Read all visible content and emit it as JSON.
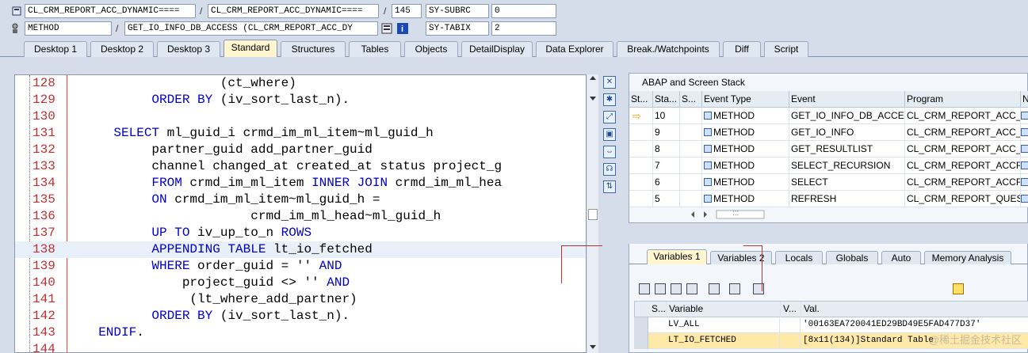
{
  "header": {
    "row1": {
      "class1": "CL_CRM_REPORT_ACC_DYNAMIC====",
      "class2": "CL_CRM_REPORT_ACC_DYNAMIC====",
      "line": "145",
      "sysfield": "SY-SUBRC",
      "sysvalue": "0"
    },
    "row2": {
      "type": "METHOD",
      "method": "GET_IO_INFO_DB_ACCESS (CL_CRM_REPORT_ACC_DY",
      "sysfield": "SY-TABIX",
      "sysvalue": "2"
    },
    "separator": "/"
  },
  "tabs": [
    {
      "label": "Desktop 1"
    },
    {
      "label": "Desktop 2"
    },
    {
      "label": "Desktop 3"
    },
    {
      "label": "Standard"
    },
    {
      "label": "Structures"
    },
    {
      "label": "Tables"
    },
    {
      "label": "Objects"
    },
    {
      "label": "DetailDisplay"
    },
    {
      "label": "Data Explorer"
    },
    {
      "label": "Break./Watchpoints"
    },
    {
      "label": "Diff"
    },
    {
      "label": "Script"
    }
  ],
  "editor": {
    "lines": [
      {
        "num": "128",
        "parts": [
          [
            "",
            "                  (ct_where)"
          ]
        ]
      },
      {
        "num": "129",
        "parts": [
          [
            "",
            "         "
          ],
          [
            "kw",
            "ORDER BY"
          ],
          [
            "",
            " (iv_sort_last_n)."
          ]
        ]
      },
      {
        "num": "130",
        "parts": [
          [
            "",
            ""
          ]
        ]
      },
      {
        "num": "131",
        "parts": [
          [
            "",
            "    "
          ],
          [
            "kw",
            "SELECT"
          ],
          [
            "",
            " ml_guid_i crmd_im_ml_item~ml_guid_h"
          ]
        ]
      },
      {
        "num": "132",
        "parts": [
          [
            "",
            "         partner_guid add_partner_guid"
          ]
        ]
      },
      {
        "num": "133",
        "parts": [
          [
            "",
            "         channel changed_at created_at status project_g"
          ]
        ]
      },
      {
        "num": "134",
        "parts": [
          [
            "",
            "         "
          ],
          [
            "kw",
            "FROM"
          ],
          [
            "",
            " crmd_im_ml_item "
          ],
          [
            "kw",
            "INNER JOIN"
          ],
          [
            "",
            " crmd_im_ml_hea"
          ]
        ]
      },
      {
        "num": "135",
        "parts": [
          [
            "",
            "         "
          ],
          [
            "kw",
            "ON"
          ],
          [
            "",
            " crmd_im_ml_item~ml_guid_h ="
          ]
        ]
      },
      {
        "num": "136",
        "parts": [
          [
            "",
            "                      crmd_im_ml_head~ml_guid_h"
          ]
        ]
      },
      {
        "num": "137",
        "parts": [
          [
            "",
            "         "
          ],
          [
            "kw",
            "UP TO"
          ],
          [
            "",
            " iv_up_to_n "
          ],
          [
            "kw",
            "ROWS"
          ]
        ]
      },
      {
        "num": "138",
        "parts": [
          [
            "",
            "         "
          ],
          [
            "kw",
            "APPENDING TABLE"
          ],
          [
            "",
            " lt_io_fetched"
          ]
        ]
      },
      {
        "num": "139",
        "parts": [
          [
            "",
            "         "
          ],
          [
            "kw",
            "WHERE"
          ],
          [
            "",
            " order_guid = '' "
          ],
          [
            "kw",
            "AND"
          ]
        ]
      },
      {
        "num": "140",
        "parts": [
          [
            "",
            "             project_guid <> '' "
          ],
          [
            "kw",
            "AND"
          ]
        ]
      },
      {
        "num": "141",
        "parts": [
          [
            "",
            "              (lt_where_add_partner)"
          ]
        ]
      },
      {
        "num": "142",
        "parts": [
          [
            "",
            "         "
          ],
          [
            "kw",
            "ORDER BY"
          ],
          [
            "",
            " (iv_sort_last_n)."
          ]
        ]
      },
      {
        "num": "143",
        "parts": [
          [
            "",
            "  "
          ],
          [
            "kw",
            "ENDIF"
          ],
          [
            "",
            "."
          ]
        ]
      },
      {
        "num": "144",
        "parts": [
          [
            "",
            ""
          ]
        ]
      }
    ],
    "highlight_line": "138"
  },
  "stack": {
    "title": "ABAP and Screen Stack",
    "columns": [
      "St...",
      "Sta...",
      "S...",
      "Event Type",
      "Event",
      "Program",
      "N"
    ],
    "rows": [
      {
        "level": "10",
        "type": "METHOD",
        "event": "GET_IO_INFO_DB_ACCE...",
        "program": "CL_CRM_REPORT_ACC_...",
        "current": true
      },
      {
        "level": "9",
        "type": "METHOD",
        "event": "GET_IO_INFO",
        "program": "CL_CRM_REPORT_ACC_...",
        "current": false
      },
      {
        "level": "8",
        "type": "METHOD",
        "event": "GET_RESULTLIST",
        "program": "CL_CRM_REPORT_ACC_...",
        "current": false
      },
      {
        "level": "7",
        "type": "METHOD",
        "event": "SELECT_RECURSION",
        "program": "CL_CRM_REPORT_ACCR...",
        "current": false
      },
      {
        "level": "6",
        "type": "METHOD",
        "event": "SELECT",
        "program": "CL_CRM_REPORT_ACCR...",
        "current": false
      },
      {
        "level": "5",
        "type": "METHOD",
        "event": "REFRESH",
        "program": "CL_CRM_REPORT_QUES...",
        "current": false
      }
    ],
    "scroll_label": ":::"
  },
  "variables": {
    "tabs": [
      "Variables 1",
      "Variables 2",
      "Locals",
      "Globals",
      "Auto",
      "Memory Analysis"
    ],
    "columns": [
      "S...",
      "Variable",
      "V...",
      "Val."
    ],
    "rows": [
      {
        "name": "LV_ALL",
        "value": "'00163EA720041ED29BD49E5FAD477D37'",
        "selected": false
      },
      {
        "name": "LT_IO_FETCHED",
        "value": "[8x11(134)]Standard Table",
        "selected": true
      }
    ]
  },
  "colors": {
    "keyword": "#0000cc",
    "line_number": "#c03030",
    "active_tab": "#fff6cf"
  },
  "watermark": "@稀土掘金技术社区"
}
